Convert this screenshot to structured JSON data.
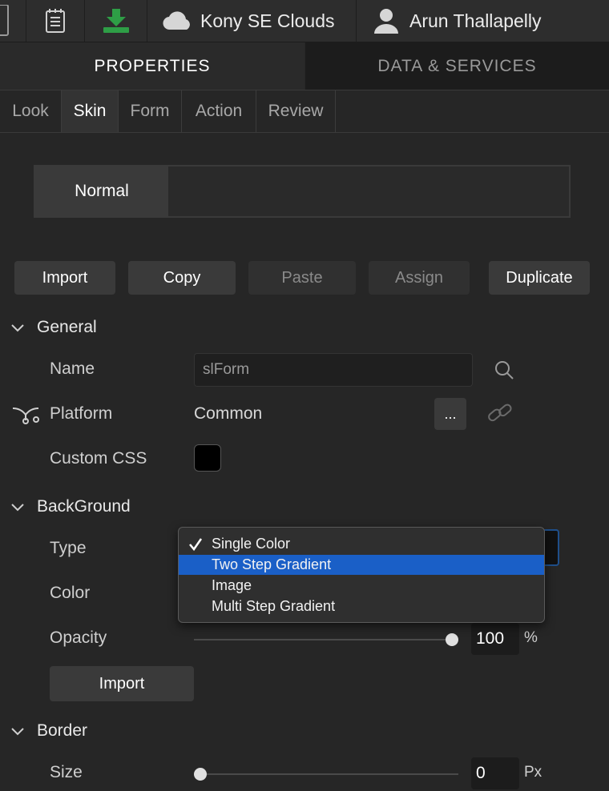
{
  "topbar": {
    "cloud_name": "Kony SE Clouds",
    "user_name": "Arun Thallapelly",
    "icons": [
      "device-icon",
      "notes-icon",
      "download-icon",
      "cloud-icon",
      "user-icon"
    ]
  },
  "panel_tabs": [
    {
      "label": "PROPERTIES",
      "active": true
    },
    {
      "label": "DATA & SERVICES",
      "active": false
    }
  ],
  "sub_tabs": [
    {
      "label": "Look",
      "active": false
    },
    {
      "label": "Skin",
      "active": true
    },
    {
      "label": "Form",
      "active": false
    },
    {
      "label": "Action",
      "active": false
    },
    {
      "label": "Review",
      "active": false
    }
  ],
  "skin_state": "Normal",
  "actions": {
    "import": "Import",
    "copy": "Copy",
    "paste": "Paste",
    "assign": "Assign",
    "duplicate": "Duplicate"
  },
  "general": {
    "title": "General",
    "name_label": "Name",
    "name_value": "slForm",
    "platform_label": "Platform",
    "platform_value": "Common",
    "platform_more": "...",
    "custom_css_label": "Custom CSS"
  },
  "background": {
    "title": "BackGround",
    "type_label": "Type",
    "color_label": "Color",
    "opacity_label": "Opacity",
    "opacity_value": "100",
    "opacity_unit": "%",
    "opacity_level": 1.0,
    "import_label": "Import",
    "type_options": [
      "Single Color",
      "Two Step Gradient",
      "Image",
      "Multi Step Gradient"
    ],
    "checked_option": "Single Color",
    "highlighted_option": "Two Step Gradient"
  },
  "border": {
    "title": "Border",
    "size_label": "Size",
    "size_value": "0",
    "size_unit": "Px",
    "size_level": 0
  },
  "colors": {
    "background": "#262626",
    "highlight": "#1a5fc7",
    "download_icon": "#2e9e46"
  }
}
